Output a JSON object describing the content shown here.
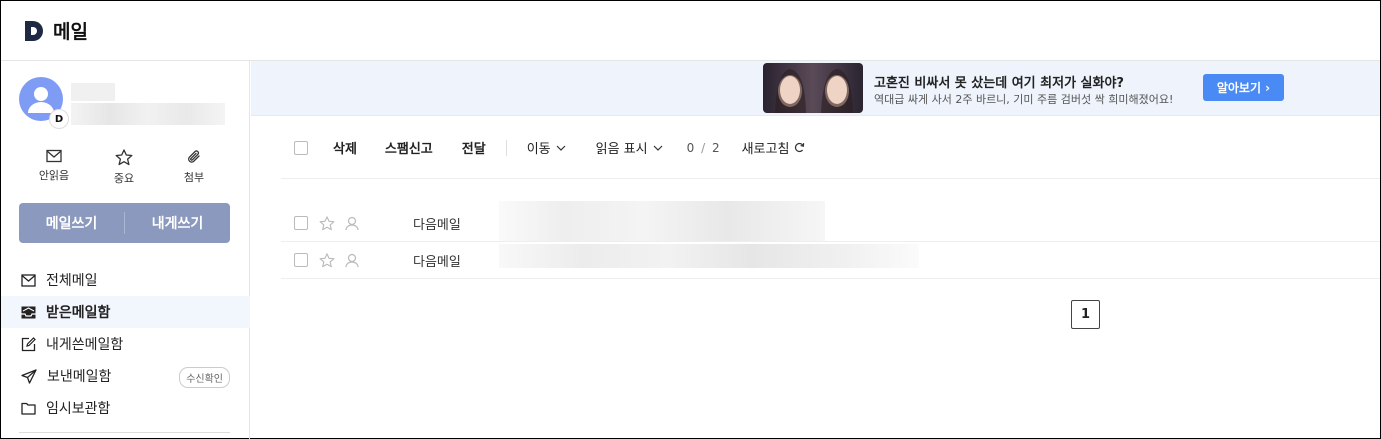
{
  "header": {
    "title": "메일",
    "logo_letter": "D"
  },
  "profile": {
    "badge_letter": "D"
  },
  "quick_actions": [
    {
      "label": "안읽음",
      "icon": "envelope-icon"
    },
    {
      "label": "중요",
      "icon": "star-icon"
    },
    {
      "label": "첨부",
      "icon": "paperclip-icon"
    }
  ],
  "compose": {
    "write_label": "메일쓰기",
    "self_label": "내게쓰기"
  },
  "nav": {
    "items": [
      {
        "label": "전체메일",
        "icon": "mail-icon"
      },
      {
        "label": "받은메일함",
        "icon": "inbox-icon",
        "active": true
      },
      {
        "label": "내게쓴메일함",
        "icon": "edit-icon"
      },
      {
        "label": "보낸메일함",
        "icon": "send-icon",
        "badge": "수신확인"
      },
      {
        "label": "임시보관함",
        "icon": "folder-icon"
      }
    ]
  },
  "ad": {
    "title": "고혼진 비싸서 못 샀는데 여기 최저가 실화야?",
    "subtitle": "역대급 싸게 사서 2주 바르니, 기미 주름 검버섯 싹 희미해졌어요!",
    "button": "알아보기 ›"
  },
  "toolbar": {
    "delete": "삭제",
    "spam": "스팸신고",
    "forward": "전달",
    "move": "이동",
    "mark_read": "읽음 표시",
    "count_current": "0",
    "count_total": "2",
    "refresh": "새로고침"
  },
  "mails": [
    {
      "sender": "다음메일"
    },
    {
      "sender": "다음메일"
    }
  ],
  "pagination": {
    "current": "1"
  },
  "colors": {
    "accent": "#4a8af4",
    "compose_bg": "#8a99bd",
    "avatar": "#7f9cf5",
    "ad_bg": "#eef3fc"
  }
}
